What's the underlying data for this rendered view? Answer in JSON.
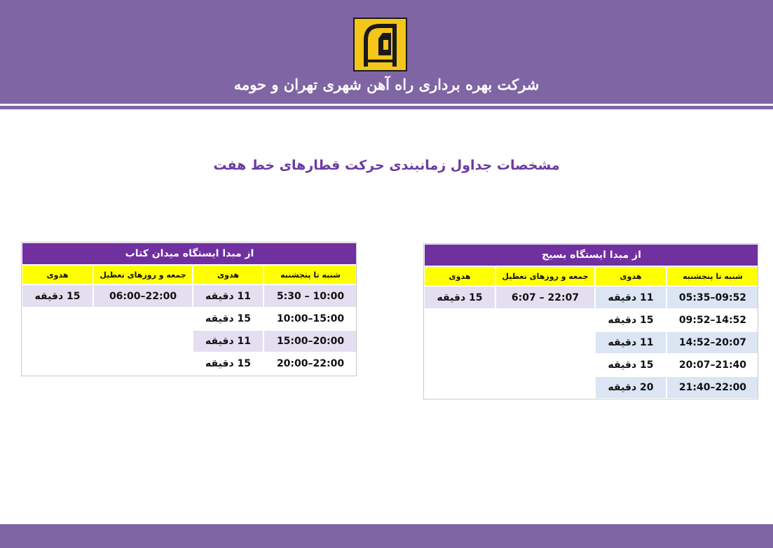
{
  "header": {
    "company_name": "شرکت بهره برداری راه آهن شهری تهران و حومه",
    "logo_icon": "tehran-metro-logo",
    "colors": {
      "banner": "#7f65a4",
      "logo_bg": "#f4c51a"
    }
  },
  "page": {
    "title": "مشخصات جداول زمانبندی حرکت قطارهای خط هفت"
  },
  "colors": {
    "table_title_bg": "#7030a0",
    "table_header_bg": "#ffff00",
    "row_shade_purple": "#e4dff0",
    "row_shade_blue": "#dbe5f4"
  },
  "tables": {
    "left": {
      "title": "از مبدا  ایستگاه میدان کتاب",
      "headers": {
        "weekdays": "شنبه تا پنجشنبه",
        "weekday_headway": "هدوی",
        "holidays": "جمعه و روزهای تعطیل",
        "holiday_headway": "هدوی"
      },
      "weekday_rows": [
        {
          "time": "5:30 – 10:00",
          "headway": "11 دقیقه"
        },
        {
          "time": "10:00–15:00",
          "headway": "15 دقیقه"
        },
        {
          "time": "15:00–20:00",
          "headway": "11  دقیقه"
        },
        {
          "time": "20:00–22:00",
          "headway": "15  دقیقه"
        }
      ],
      "holiday_row": {
        "time": "06:00–22:00",
        "headway": "15 دقیقه"
      }
    },
    "right": {
      "title": "از مبدا ایستگاه بسیج",
      "headers": {
        "weekdays": "شنبه تا پنجشنبه",
        "weekday_headway": "هدوی",
        "holidays": "جمعه و روزهای تعطیل",
        "holiday_headway": "هدوی"
      },
      "weekday_rows": [
        {
          "time": "05:35–09:52",
          "headway": "11 دقیقه"
        },
        {
          "time": "09:52–14:52",
          "headway": "15 دقیقه"
        },
        {
          "time": "14:52–20:07",
          "headway": "11  دقیقه"
        },
        {
          "time": "20:07–21:40",
          "headway": "15  دقیقه"
        },
        {
          "time": "21:40–22:00",
          "headway": "20  دقیقه"
        }
      ],
      "holiday_row": {
        "time": "6:07 – 22:07",
        "headway": "15 دقیقه"
      }
    }
  }
}
